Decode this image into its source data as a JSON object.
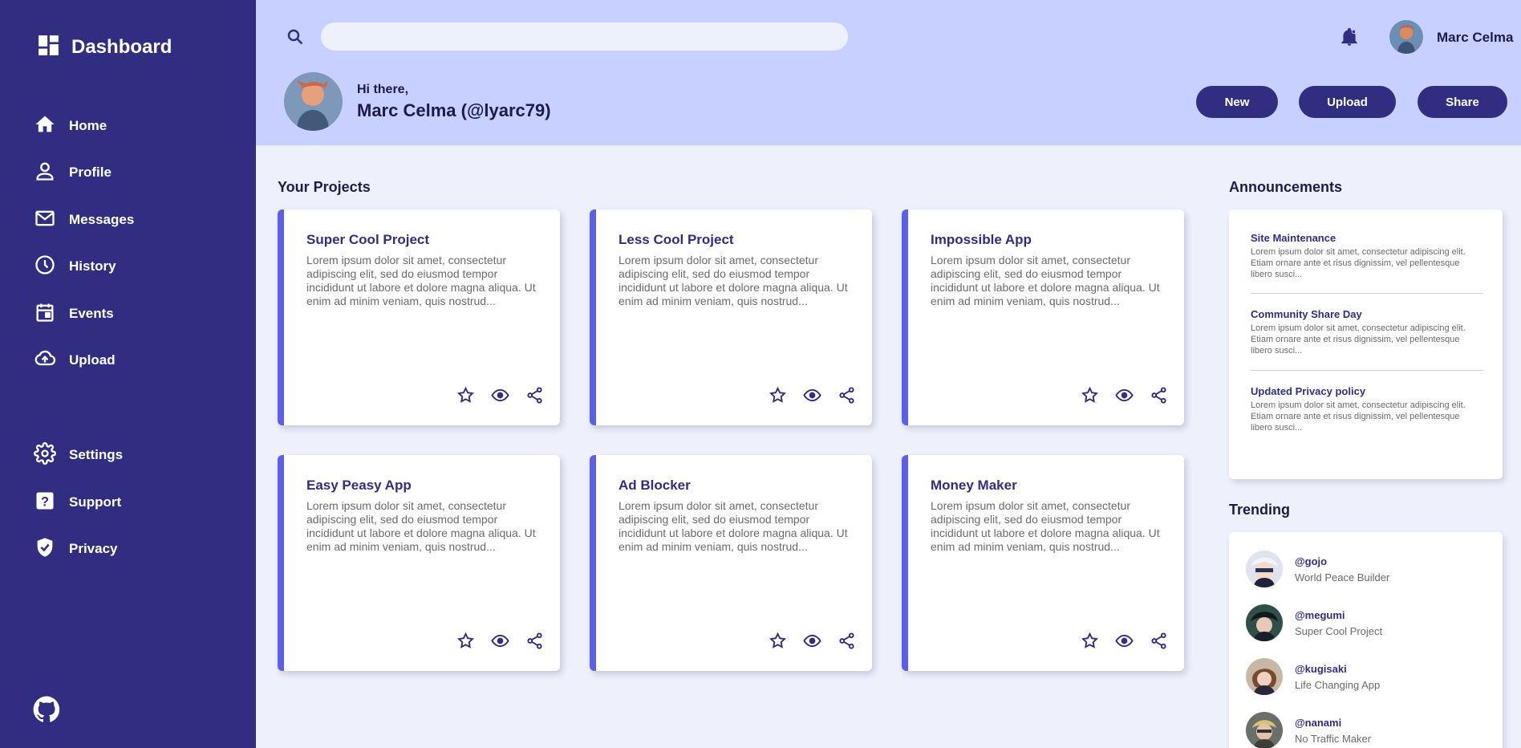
{
  "colors": {
    "sidebar": "#312e81",
    "header": "#c7d0fe",
    "background": "#eef0fc",
    "accent": "#5b5fe9",
    "card": "#ffffff"
  },
  "sidebar": {
    "title": "Dashboard",
    "logo_icon": "dashboard-icon",
    "items": [
      {
        "label": "Home",
        "icon": "home-icon"
      },
      {
        "label": "Profile",
        "icon": "profile-icon"
      },
      {
        "label": "Messages",
        "icon": "mail-icon"
      },
      {
        "label": "History",
        "icon": "clock-icon"
      },
      {
        "label": "Events",
        "icon": "calendar-icon"
      },
      {
        "label": "Upload",
        "icon": "cloud-upload-icon"
      }
    ],
    "bottom_items": [
      {
        "label": "Settings",
        "icon": "gear-icon"
      },
      {
        "label": "Support",
        "icon": "help-icon"
      },
      {
        "label": "Privacy",
        "icon": "shield-icon"
      }
    ],
    "footer_icon": "github-icon"
  },
  "header": {
    "search_placeholder": "",
    "username": "Marc Celma",
    "greeting": "Hi there,",
    "full_name": "Marc Celma (@lyarc79)",
    "buttons": {
      "new": "New",
      "upload": "Upload",
      "share": "Share"
    }
  },
  "projects": {
    "title": "Your Projects",
    "items": [
      {
        "title": "Super Cool Project",
        "description": "Lorem ipsum dolor sit amet, consectetur adipiscing elit, sed do eiusmod tempor incididunt ut labore et dolore magna aliqua. Ut enim ad minim veniam, quis nostrud..."
      },
      {
        "title": "Less Cool Project",
        "description": "Lorem ipsum dolor sit amet, consectetur adipiscing elit, sed do eiusmod tempor incididunt ut labore et dolore magna aliqua. Ut enim ad minim veniam, quis nostrud..."
      },
      {
        "title": "Impossible App",
        "description": "Lorem ipsum dolor sit amet, consectetur adipiscing elit, sed do eiusmod tempor incididunt ut labore et dolore magna aliqua. Ut enim ad minim veniam, quis nostrud..."
      },
      {
        "title": "Easy Peasy App",
        "description": "Lorem ipsum dolor sit amet, consectetur adipiscing elit, sed do eiusmod tempor incididunt ut labore et dolore magna aliqua. Ut enim ad minim veniam, quis nostrud..."
      },
      {
        "title": "Ad Blocker",
        "description": "Lorem ipsum dolor sit amet, consectetur adipiscing elit, sed do eiusmod tempor incididunt ut labore et dolore magna aliqua. Ut enim ad minim veniam, quis nostrud..."
      },
      {
        "title": "Money Maker",
        "description": "Lorem ipsum dolor sit amet, consectetur adipiscing elit, sed do eiusmod tempor incididunt ut labore et dolore magna aliqua. Ut enim ad minim veniam, quis nostrud..."
      }
    ]
  },
  "announcements": {
    "title": "Announcements",
    "items": [
      {
        "title": "Site Maintenance",
        "body": "Lorem ipsum dolor sit amet, consectetur adipiscing elit. Etiam ornare ante et risus dignissim, vel pellentesque libero susci..."
      },
      {
        "title": "Community Share Day",
        "body": "Lorem ipsum dolor sit amet, consectetur adipiscing elit. Etiam ornare ante et risus dignissim, vel pellentesque libero susci..."
      },
      {
        "title": "Updated Privacy policy",
        "body": "Lorem ipsum dolor sit amet, consectetur adipiscing elit. Etiam ornare ante et risus dignissim, vel pellentesque libero susci..."
      }
    ]
  },
  "trending": {
    "title": "Trending",
    "items": [
      {
        "handle": "@gojo",
        "project": "World Peace Builder"
      },
      {
        "handle": "@megumi",
        "project": "Super Cool Project"
      },
      {
        "handle": "@kugisaki",
        "project": "Life Changing App"
      },
      {
        "handle": "@nanami",
        "project": "No Traffic Maker"
      }
    ]
  }
}
